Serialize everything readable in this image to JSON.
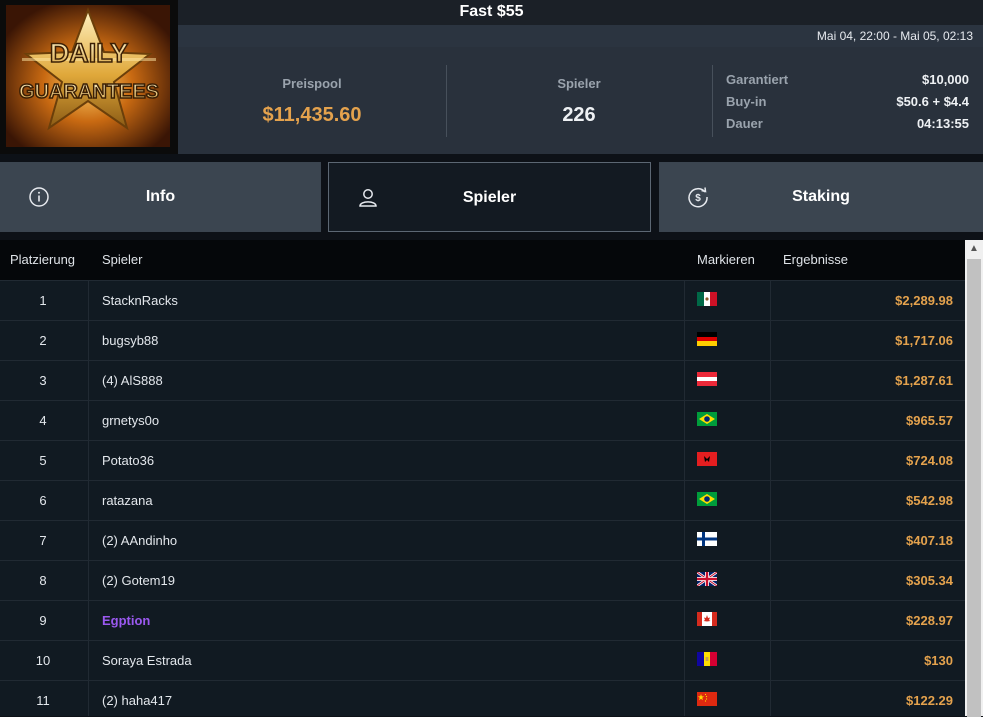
{
  "header": {
    "title": "Fast $55",
    "date_range": "Mai 04, 22:00 - Mai 05, 02:13",
    "logo_text": [
      "DAILY",
      "GUARANTEES"
    ]
  },
  "summary": {
    "prize_pool_label": "Preispool",
    "prize_pool_value": "$11,435.60",
    "players_label": "Spieler",
    "players_value": "226",
    "guaranteed_label": "Garantiert",
    "guaranteed_value": "$10,000",
    "buyin_label": "Buy-in",
    "buyin_value": "$50.6 + $4.4",
    "duration_label": "Dauer",
    "duration_value": "04:13:55"
  },
  "tabs": [
    {
      "label": "Info",
      "icon": "info-icon",
      "active": false
    },
    {
      "label": "Spieler",
      "icon": "user-icon",
      "active": true
    },
    {
      "label": "Staking",
      "icon": "dollar-cycle-icon",
      "active": false
    }
  ],
  "table": {
    "columns": [
      "Platzierung",
      "Spieler",
      "Markieren",
      "Ergebnisse"
    ],
    "rows": [
      {
        "rank": "1",
        "name": "StacknRacks",
        "flag": "mexico",
        "result": "$2,289.98"
      },
      {
        "rank": "2",
        "name": "bugsyb88",
        "flag": "germany",
        "result": "$1,717.06"
      },
      {
        "rank": "3",
        "name": "(4) AlS888",
        "flag": "austria",
        "result": "$1,287.61"
      },
      {
        "rank": "4",
        "name": "grnetys0o",
        "flag": "brazil",
        "result": "$965.57"
      },
      {
        "rank": "5",
        "name": "Potato36",
        "flag": "albania",
        "result": "$724.08"
      },
      {
        "rank": "6",
        "name": "ratazana",
        "flag": "brazil",
        "result": "$542.98"
      },
      {
        "rank": "7",
        "name": "(2) AAndinho",
        "flag": "finland",
        "result": "$407.18"
      },
      {
        "rank": "8",
        "name": "(2) Gotem19",
        "flag": "united-kingdom",
        "result": "$305.34"
      },
      {
        "rank": "9",
        "name": "Egption",
        "flag": "canada",
        "result": "$228.97",
        "highlight": true
      },
      {
        "rank": "10",
        "name": "Soraya Estrada",
        "flag": "andorra",
        "result": "$130"
      },
      {
        "rank": "11",
        "name": "(2) haha417",
        "flag": "china",
        "result": "$122.29"
      }
    ]
  },
  "colors": {
    "accent_gold": "#e4a24d",
    "highlight_purple": "#9b59f0"
  }
}
